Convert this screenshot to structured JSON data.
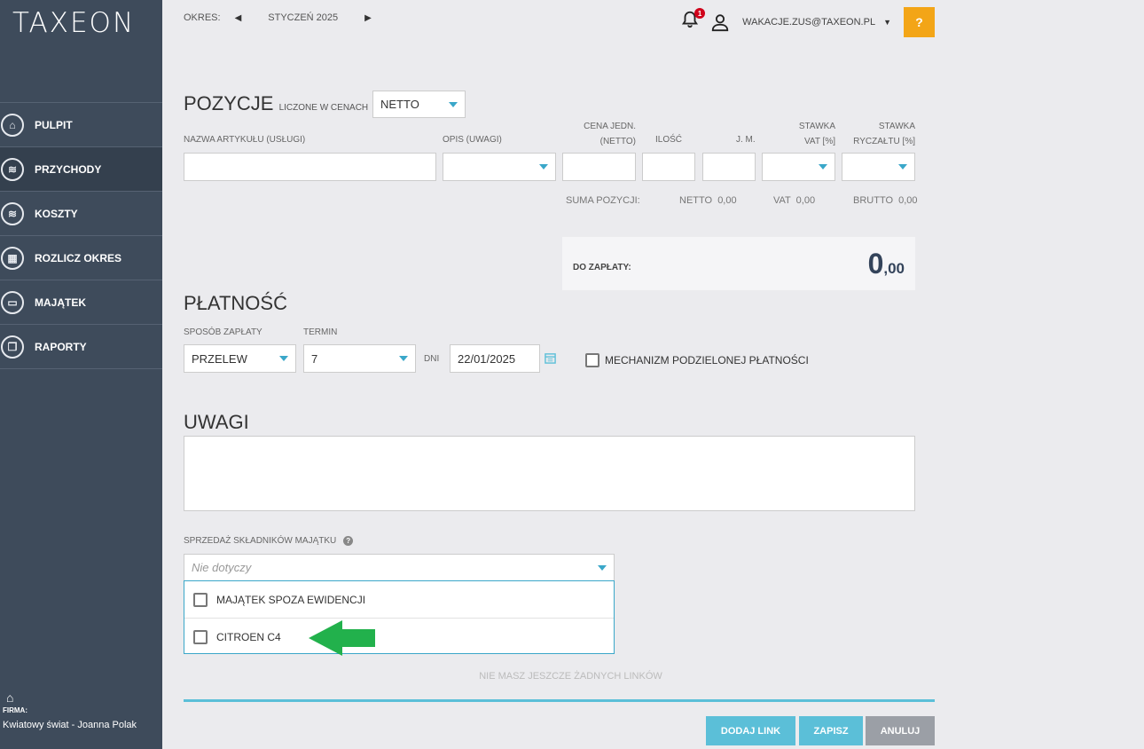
{
  "brand": {
    "logo": "TAXEON"
  },
  "sidebar": {
    "items": [
      {
        "label": "PULPIT",
        "icon": "home-icon"
      },
      {
        "label": "PRZYCHODY",
        "icon": "coins-plus-icon"
      },
      {
        "label": "KOSZTY",
        "icon": "coins-minus-icon"
      },
      {
        "label": "ROZLICZ OKRES",
        "icon": "calculator-icon"
      },
      {
        "label": "MAJĄTEK",
        "icon": "laptop-icon"
      },
      {
        "label": "RAPORTY",
        "icon": "copy-icon"
      }
    ],
    "firma_label": "FIRMA:",
    "firma_name": "Kwiatowy świat - Joanna Polak"
  },
  "topbar": {
    "okres_label": "OKRES:",
    "period": "STYCZEŃ 2025",
    "notification_count": "1",
    "user_email": "WAKACJE.ZUS@TAXEON.PL",
    "help_label": "?"
  },
  "pozycje": {
    "title": "POZYCJE",
    "subtitle": "LICZONE W CENACH",
    "price_mode": "NETTO",
    "col_name": "NAZWA ARTYKUŁU (USŁUGI)",
    "col_desc": "OPIS (UWAGI)",
    "col_price_1": "CENA JEDN.",
    "col_price_2": "(NETTO)",
    "col_qty": "ILOŚĆ",
    "col_unit": "J. M.",
    "col_vat_1": "STAWKA",
    "col_vat_2": "VAT [%]",
    "col_lump_1": "STAWKA",
    "col_lump_2": "RYCZAŁTU [%]",
    "sum_label": "SUMA POZYCJI:",
    "sum_netto": "NETTO  0,00",
    "sum_vat": "VAT  0,00",
    "sum_brutto": "BRUTTO  0,00",
    "to_pay_label": "DO ZAPŁATY:",
    "to_pay_int": "0",
    "to_pay_dec": ",00"
  },
  "platnosc": {
    "title": "PŁATNOŚĆ",
    "method_label": "SPOSÓB ZAPŁATY",
    "method_value": "PRZELEW",
    "term_label": "TERMIN",
    "term_value": "7",
    "days_label": "DNI",
    "date_value": "22/01/2025",
    "split_label": "MECHANIZM PODZIELONEJ PŁATNOŚCI"
  },
  "uwagi": {
    "title": "UWAGI"
  },
  "assets": {
    "label": "SPRZEDAŻ SKŁADNIKÓW MAJĄTKU",
    "placeholder": "Nie dotyczy",
    "options": [
      "MAJĄTEK SPOZA EWIDENCJI",
      "CITROEN C4"
    ]
  },
  "links": {
    "empty_text": "NIE MASZ JESZCZE ŻADNYCH LINKÓW"
  },
  "actions": {
    "add_link": "DODAJ LINK",
    "save": "ZAPISZ",
    "cancel": "ANULUJ"
  },
  "colors": {
    "sidebar": "#3e4b5b",
    "accent": "#5bbfd8",
    "help": "#f3a517",
    "annotation_arrow": "#22b14c",
    "cancel": "#9b9fa6"
  }
}
